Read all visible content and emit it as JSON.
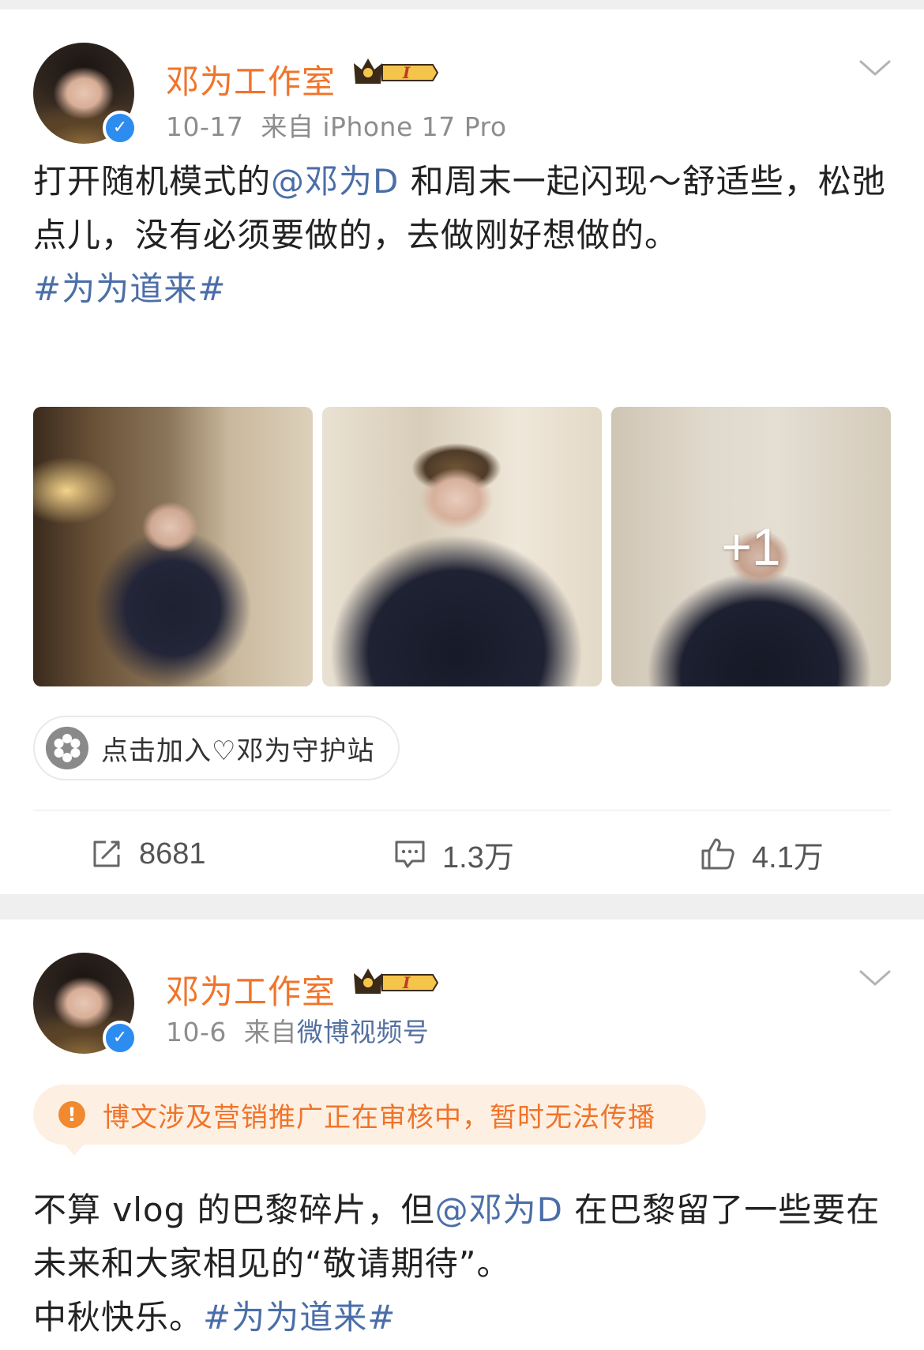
{
  "colors": {
    "username": "#f0742a",
    "link": "#4b6ea8",
    "meta_gray": "#8d8d8d",
    "verified_blue": "#2d8cf0",
    "notice_bg": "#fdf0e3",
    "notice_text": "#f0742a"
  },
  "posts": [
    {
      "author": "邓为工作室",
      "badge_text": "I",
      "date": "10-17",
      "source_prefix": "来自",
      "source": "iPhone 17 Pro",
      "text_parts": [
        {
          "type": "text",
          "value": "打开随机模式的"
        },
        {
          "type": "mention",
          "value": "@邓为D"
        },
        {
          "type": "text",
          "value": " 和周末一起闪现～舒适些，松弛点儿，没有必须要做的，去做刚好想做的。"
        }
      ],
      "hashtag": "#为为道来#",
      "images_more": "+1",
      "join_label": "点击加入♡邓为守护站",
      "repost_count": "8681",
      "comment_count": "1.3万",
      "like_count": "4.1万"
    },
    {
      "author": "邓为工作室",
      "badge_text": "I",
      "date": "10-6",
      "source_prefix": "来自",
      "source": "微博视频号",
      "notice": "博文涉及营销推广正在审核中，暂时无法传播",
      "text_line1_a": "不算 vlog 的巴黎碎片，但",
      "text_mention": "@邓为D",
      "text_line1_b": " 在巴黎留了一些要在未来和大家相见的“敬请期待”。",
      "text_line2": "中秋快乐。",
      "hashtag": "#为为道来#"
    }
  ]
}
